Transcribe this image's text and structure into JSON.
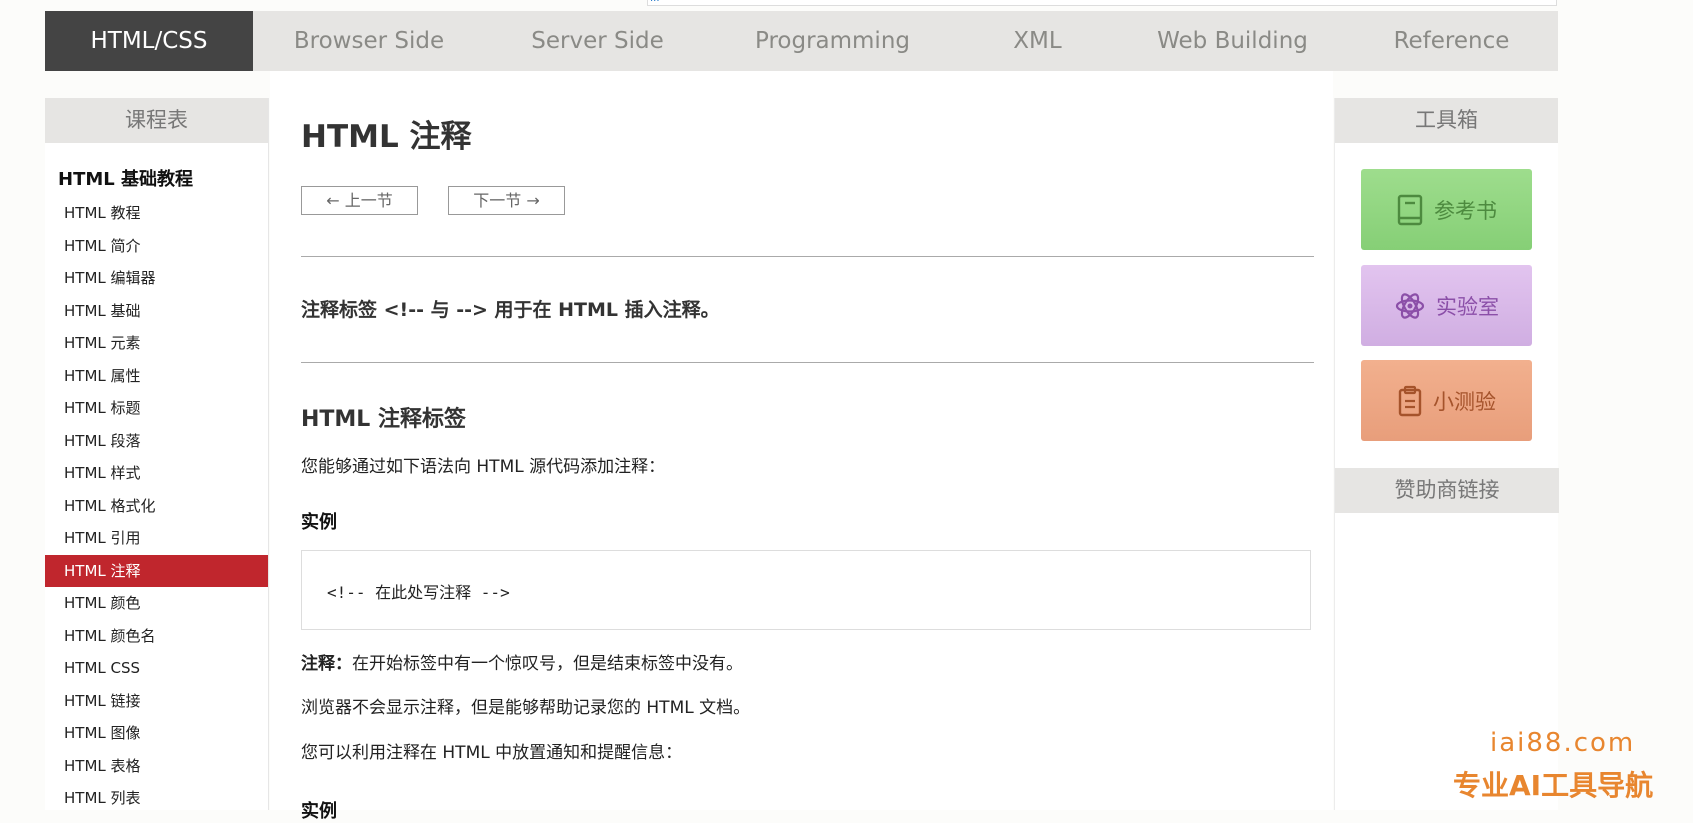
{
  "top_fragment": "...",
  "nav": {
    "items": [
      "HTML/CSS",
      "Browser Side",
      "Server Side",
      "Programming",
      "XML",
      "Web Building",
      "Reference"
    ],
    "active_index": 0
  },
  "left_sidebar": {
    "title": "课程表",
    "group": "HTML 基础教程",
    "items": [
      "HTML 教程",
      "HTML 简介",
      "HTML 编辑器",
      "HTML 基础",
      "HTML 元素",
      "HTML 属性",
      "HTML 标题",
      "HTML 段落",
      "HTML 样式",
      "HTML 格式化",
      "HTML 引用",
      "HTML 注释",
      "HTML 颜色",
      "HTML 颜色名",
      "HTML CSS",
      "HTML 链接",
      "HTML 图像",
      "HTML 表格",
      "HTML 列表"
    ],
    "active_index": 11
  },
  "main": {
    "title": "HTML 注释",
    "prev_label": "上一节",
    "next_label": "下一节",
    "intro": "注释标签 <!-- 与 --> 用于在 HTML 插入注释。",
    "section_title": "HTML 注释标签",
    "section_text": "您能够通过如下语法向 HTML 源代码添加注释：",
    "example_label": "实例",
    "code": "<!-- 在此处写注释 -->",
    "note_bold": "注释：",
    "note_text": "在开始标签中有一个惊叹号，但是结束标签中没有。",
    "para2": "浏览器不会显示注释，但是能够帮助记录您的 HTML 文档。",
    "para3": "您可以利用注释在 HTML 中放置通知和提醒信息：",
    "example_label2": "实例"
  },
  "right_sidebar": {
    "title": "工具箱",
    "tools": [
      {
        "label": "参考书",
        "icon": "book-icon"
      },
      {
        "label": "实验室",
        "icon": "atom-icon"
      },
      {
        "label": "小测验",
        "icon": "clipboard-icon"
      }
    ],
    "sponsor_title": "赞助商链接"
  },
  "watermark": {
    "line1": "iai88.com",
    "line2": "专业AI工具导航"
  }
}
